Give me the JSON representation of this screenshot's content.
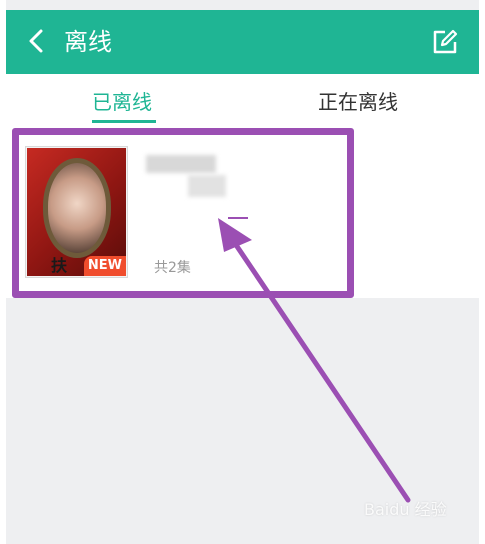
{
  "header": {
    "title": "离线",
    "back_icon": "chevron-left-icon",
    "edit_icon": "edit-icon",
    "background_color": "#1fb594"
  },
  "tabs": [
    {
      "label": "已离线",
      "selected": true
    },
    {
      "label": "正在离线",
      "selected": false
    }
  ],
  "items": [
    {
      "poster_title": "扶",
      "badge": "NEW",
      "episodes": "共2集"
    }
  ],
  "annotation": {
    "color": "#9b4fb3"
  },
  "watermark": "Baidu 经验"
}
